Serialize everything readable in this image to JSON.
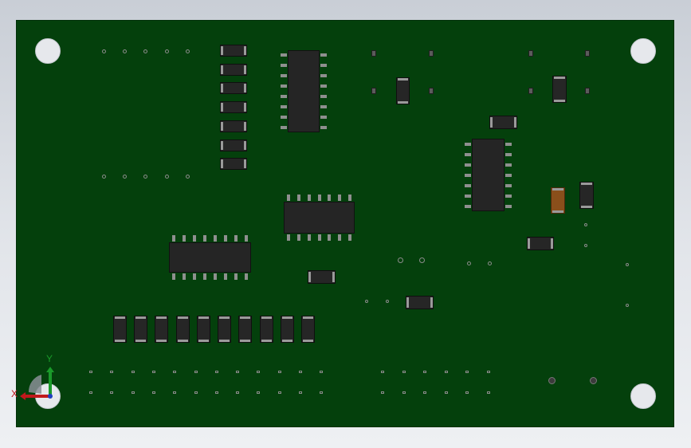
{
  "viewport": {
    "triad": {
      "x_label": "X",
      "y_label": "Y"
    },
    "colors": {
      "background_top": "#c9ced6",
      "background_bottom": "#eef0f3",
      "board": "#04400c",
      "ic_body": "#252525",
      "axis_x": "#c0181c",
      "axis_y": "#1a9a2a"
    }
  }
}
